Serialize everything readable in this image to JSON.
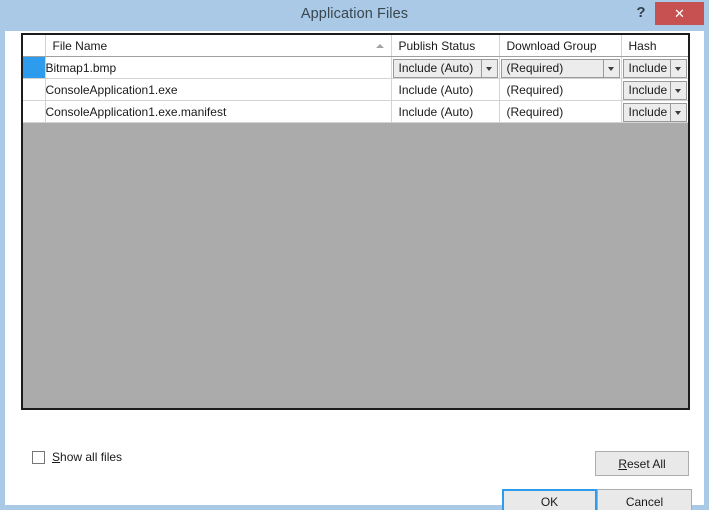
{
  "window": {
    "title": "Application Files",
    "help_label": "?",
    "close_label": "✕"
  },
  "grid": {
    "columns": [
      {
        "key": "row_selector",
        "label": ""
      },
      {
        "key": "file_name",
        "label": "File Name",
        "sort": "ascending"
      },
      {
        "key": "publish_status",
        "label": "Publish Status"
      },
      {
        "key": "download_group",
        "label": "Download Group"
      },
      {
        "key": "hash",
        "label": "Hash"
      }
    ],
    "rows": [
      {
        "selected": true,
        "file_name": "Bitmap1.bmp",
        "publish_status": "Include (Auto)",
        "download_group": "(Required)",
        "hash": "Include"
      },
      {
        "selected": false,
        "file_name": "ConsoleApplication1.exe",
        "publish_status": "Include (Auto)",
        "download_group": "(Required)",
        "hash": "Include"
      },
      {
        "selected": false,
        "file_name": "ConsoleApplication1.exe.manifest",
        "publish_status": "Include (Auto)",
        "download_group": "(Required)",
        "hash": "Include"
      }
    ]
  },
  "footer": {
    "show_all_files_label_prefix": "",
    "show_all_files_accel": "S",
    "show_all_files_label_rest": "how all files",
    "show_all_files_checked": false,
    "reset_all_accel": "R",
    "reset_all_rest": "eset All",
    "ok_label": "OK",
    "cancel_label": "Cancel"
  },
  "colors": {
    "titlebar": "#a9c9e6",
    "close_button": "#c75050",
    "grid_empty": "#ababab",
    "row_selector_selected": "#2e9ced",
    "focus_outline": "#2e9ced"
  }
}
